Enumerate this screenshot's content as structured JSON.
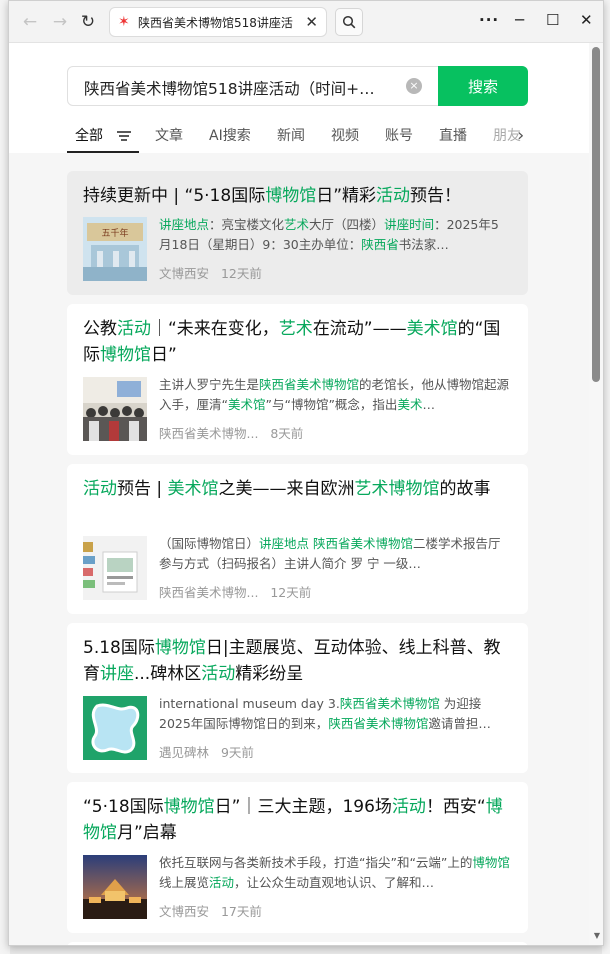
{
  "browser": {
    "tab_title": "陕西省美术博物馆518讲座活",
    "nav_back": "←",
    "nav_forward": "→",
    "reload": "↻",
    "tab_close": "✕",
    "win_more": "···",
    "win_min": "─",
    "win_max": "☐",
    "win_close": "✕"
  },
  "search": {
    "query": "陕西省美术博物馆518讲座活动（时间+…",
    "clear": "×",
    "button_label": "搜索"
  },
  "filters": [
    "全部",
    "文章",
    "AI搜索",
    "新闻",
    "视频",
    "账号",
    "直播",
    "朋友"
  ],
  "results": [
    {
      "title_parts": [
        [
          "持续更新中 | “5·18国际",
          false
        ],
        [
          "博物馆",
          true
        ],
        [
          "日”精彩",
          false
        ],
        [
          "活动",
          true
        ],
        [
          "预告！",
          false
        ]
      ],
      "snippet_parts": [
        [
          "讲座地点",
          true
        ],
        [
          "：亮宝楼文化",
          false
        ],
        [
          "艺术",
          true
        ],
        [
          "大厅（四楼）",
          false
        ],
        [
          "讲座时间",
          true
        ],
        [
          "：2025年5月18日（星期日）9：30主办单位：",
          false
        ],
        [
          "陕西省",
          true
        ],
        [
          "书法家…",
          false
        ]
      ],
      "source": "文博西安",
      "time": "12天前",
      "thumb": "thumb-stage"
    },
    {
      "title_parts": [
        [
          "公教",
          false
        ],
        [
          "活动",
          true
        ],
        [
          "｜“未来在变化，",
          false
        ],
        [
          "艺术",
          true
        ],
        [
          "在流动”——",
          false
        ],
        [
          "美术馆",
          true
        ],
        [
          "的“国际",
          false
        ],
        [
          "博物馆",
          true
        ],
        [
          "日”",
          false
        ]
      ],
      "snippet_parts": [
        [
          "主讲人罗宁先生是",
          false
        ],
        [
          "陕西省美术博物馆",
          true
        ],
        [
          "的老馆长，他从博物馆起源入手，厘清“",
          false
        ],
        [
          "美术馆",
          true
        ],
        [
          "”与“博物馆”概念，指出",
          false
        ],
        [
          "美术",
          true
        ],
        [
          "…",
          false
        ]
      ],
      "source": "陕西省美术博物...",
      "time": "8天前",
      "thumb": "thumb-group"
    },
    {
      "title_parts": [
        [
          "活动",
          true
        ],
        [
          "预告 | ",
          false
        ],
        [
          "美术馆",
          true
        ],
        [
          "之美——来自欧洲",
          false
        ],
        [
          "艺术博物馆",
          true
        ],
        [
          "的故事",
          false
        ]
      ],
      "snippet_parts": [
        [
          "（国际博物馆日）",
          false
        ],
        [
          "讲座地点 陕西省美术博物馆",
          true
        ],
        [
          "二楼学术报告厅 参与方式（扫码报名）主讲人简介 罗 宁 一级…",
          false
        ]
      ],
      "source": "陕西省美术博物...",
      "time": "12天前",
      "thumb": "thumb-book"
    },
    {
      "title_parts": [
        [
          "5.18国际",
          false
        ],
        [
          "博物馆",
          true
        ],
        [
          "日|主题展览、互动体验、线上科普、教育",
          false
        ],
        [
          "讲座",
          true
        ],
        [
          "...碑林区",
          false
        ],
        [
          "活动",
          true
        ],
        [
          "精彩纷呈",
          false
        ]
      ],
      "snippet_parts": [
        [
          "international museum day 3.",
          false
        ],
        [
          "陕西省美术博物馆",
          true
        ],
        [
          " 为迎接2025年国际博物馆日的到来，",
          false
        ],
        [
          "陕西省美术博物馆",
          true
        ],
        [
          "邀请曾担…",
          false
        ]
      ],
      "source": "遇见碑林",
      "time": "9天前",
      "thumb": "thumb-blob"
    },
    {
      "title_parts": [
        [
          "“5·18国际",
          false
        ],
        [
          "博物馆",
          true
        ],
        [
          "日”｜三大主题，196场",
          false
        ],
        [
          "活动",
          true
        ],
        [
          "！西安“",
          false
        ],
        [
          "博物馆",
          true
        ],
        [
          "月”启幕",
          false
        ]
      ],
      "snippet_parts": [
        [
          "依托互联网与各类新技术手段，打造“指尖”和“云端”上的",
          false
        ],
        [
          "博物馆",
          true
        ],
        [
          "线上展览",
          false
        ],
        [
          "活动",
          true
        ],
        [
          "，让公众生动直观地认识、了解和…",
          false
        ]
      ],
      "source": "文博西安",
      "time": "17天前",
      "thumb": "thumb-night"
    }
  ]
}
